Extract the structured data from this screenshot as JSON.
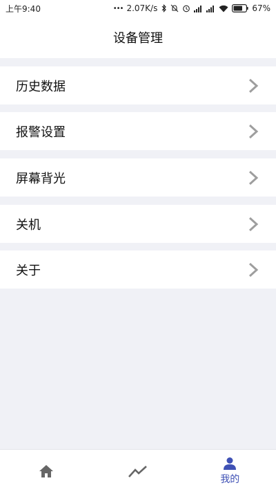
{
  "status_bar": {
    "time": "上午9:40",
    "dots": "•••",
    "speed": "2.07K/s",
    "battery": "67%"
  },
  "header": {
    "title": "设备管理"
  },
  "menu": {
    "items": [
      {
        "label": "历史数据"
      },
      {
        "label": "报警设置"
      },
      {
        "label": "屏幕背光"
      },
      {
        "label": "关机"
      },
      {
        "label": "关于"
      }
    ]
  },
  "tabbar": {
    "tabs": [
      {
        "icon": "home-icon",
        "label": ""
      },
      {
        "icon": "trend-chart-icon",
        "label": ""
      },
      {
        "icon": "person-icon",
        "label": "我的",
        "active": true
      }
    ]
  },
  "colors": {
    "accent": "#3f51b5",
    "background": "#f0f1f6",
    "icon_gray": "#666666",
    "chevron": "#9e9e9e"
  }
}
